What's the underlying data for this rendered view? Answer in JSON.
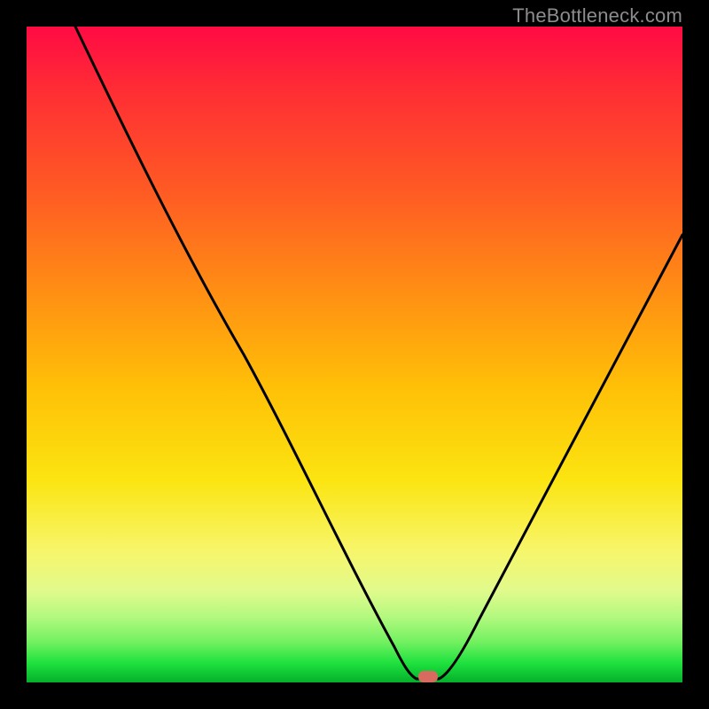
{
  "attribution": "TheBottleneck.com",
  "chart_data": {
    "type": "line",
    "title": "",
    "xlabel": "",
    "ylabel": "",
    "xlim": [
      0,
      100
    ],
    "ylim": [
      0,
      100
    ],
    "grid": false,
    "legend": false,
    "x": [
      0,
      5,
      10,
      15,
      20,
      25,
      30,
      35,
      40,
      45,
      50,
      55,
      59,
      61,
      63,
      65,
      70,
      75,
      80,
      85,
      90,
      95,
      100
    ],
    "values": [
      100,
      92,
      84,
      76,
      68,
      60,
      51,
      42,
      33,
      24,
      15,
      6,
      0,
      0,
      0,
      3,
      10,
      19,
      28,
      38,
      48,
      58,
      68
    ],
    "marker": {
      "x": 60,
      "y": 0,
      "color": "#d96a5f",
      "shape": "rounded-rect"
    },
    "background_gradient_stops": [
      {
        "pos": 0.0,
        "color": "#ff0a44"
      },
      {
        "pos": 0.25,
        "color": "#ff5a24"
      },
      {
        "pos": 0.55,
        "color": "#ffc007"
      },
      {
        "pos": 0.8,
        "color": "#f7f66b"
      },
      {
        "pos": 0.94,
        "color": "#6ff05f"
      },
      {
        "pos": 1.0,
        "color": "#04b02b"
      }
    ]
  }
}
